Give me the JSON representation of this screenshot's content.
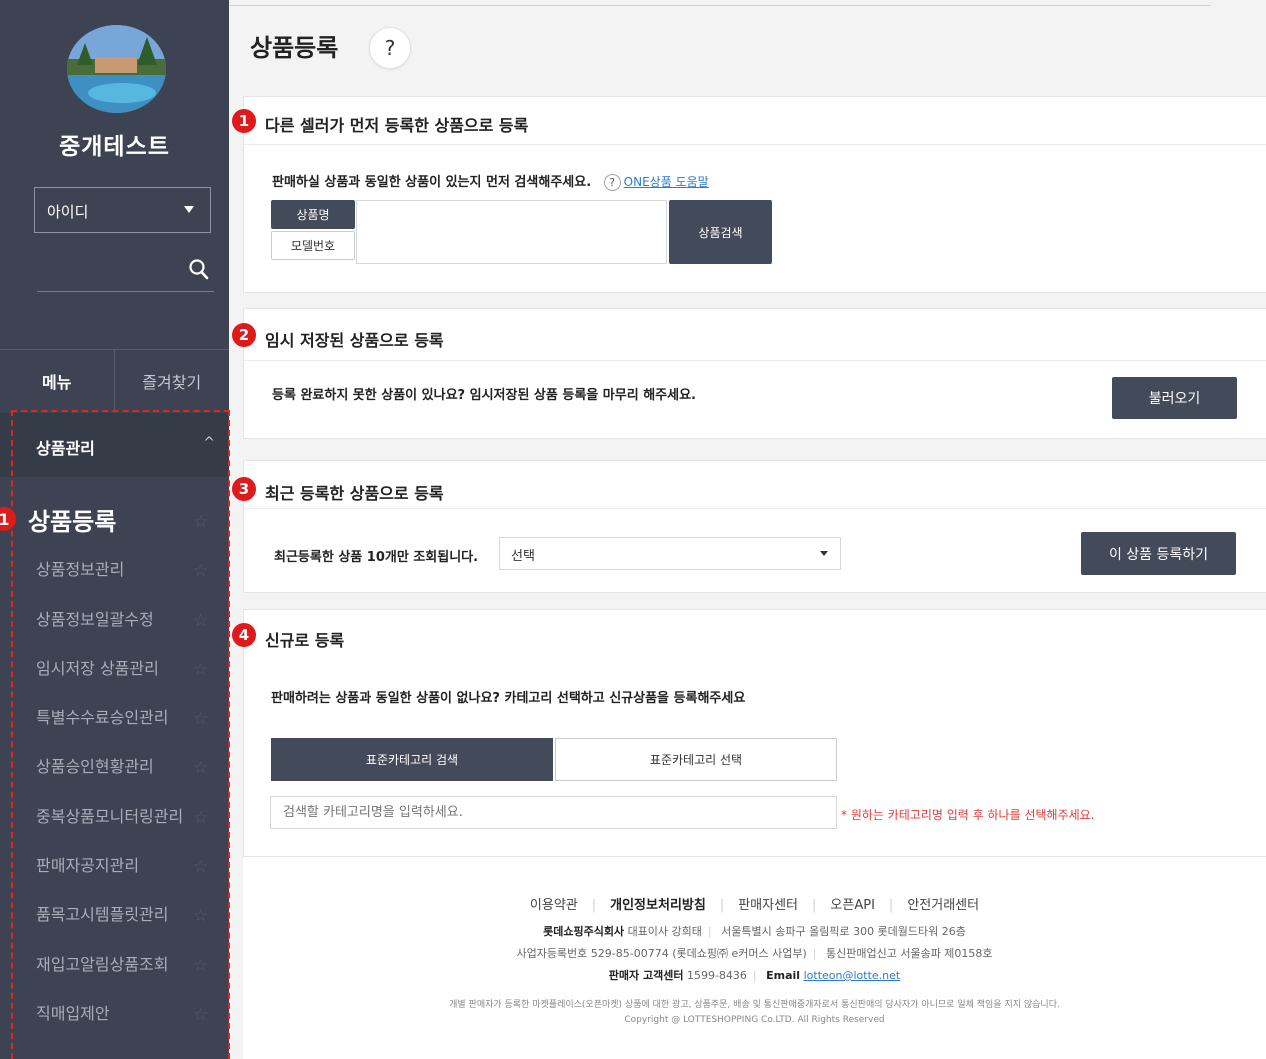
{
  "sidebar": {
    "shop_name": "중개테스트",
    "id_select": "아이디",
    "tabs": {
      "menu": "메뉴",
      "favorites": "즐겨찾기"
    },
    "group_title": "상품관리",
    "badge_num": "1",
    "items": [
      {
        "label": "상품등록"
      },
      {
        "label": "상품정보관리"
      },
      {
        "label": "상품정보일괄수정"
      },
      {
        "label": "임시저장 상품관리"
      },
      {
        "label": "특별수수료승인관리"
      },
      {
        "label": "상품승인현황관리"
      },
      {
        "label": "중복상품모니터링관리"
      },
      {
        "label": "판매자공지관리"
      },
      {
        "label": "품목고시템플릿관리"
      },
      {
        "label": "재입고알림상품조회"
      },
      {
        "label": "직매입제안"
      }
    ]
  },
  "page": {
    "title": "상품등록",
    "help_mark": "?"
  },
  "section1": {
    "num": "1",
    "title": "다른 셀러가 먼저 등록한 상품으로 등록",
    "desc": "판매하실 상품과 동일한 상품이 있는지 먼저 검색해주세요.",
    "help_mark": "?",
    "help_link": "ONE상품 도움말",
    "tab_name": "상품명",
    "tab_model": "모델번호",
    "search_btn": "상품검색"
  },
  "section2": {
    "num": "2",
    "title": "임시 저장된 상품으로 등록",
    "desc": "등록 완료하지 못한 상품이 있나요? 임시저장된 상품 등록을 마무리 해주세요.",
    "load_btn": "불러오기"
  },
  "section3": {
    "num": "3",
    "title": "최근 등록한 상품으로 등록",
    "desc": "최근등록한 상품 10개만 조회됩니다.",
    "select_value": "선택",
    "register_btn": "이 상품 등록하기"
  },
  "section4": {
    "num": "4",
    "title": "신규로 등록",
    "desc": "판매하려는 상품과 동일한 상품이 없나요? 카테고리 선택하고 신규상품을 등록해주세요",
    "tab_search": "표준카테고리 검색",
    "tab_select": "표준카테고리 선택",
    "input_placeholder": "검색할 카테고리명을 입력하세요.",
    "hint": "* 원하는 카테고리명 입력 후 하나를 선택해주세요."
  },
  "footer": {
    "links": [
      "이용약관",
      "개인정보처리방침",
      "판매자센터",
      "오픈API",
      "안전거래센터"
    ],
    "company": "롯데쇼핑주식회사",
    "ceo_label": "대표이사",
    "ceo": "강희태",
    "address": "서울특별시 송파구 올림픽로 300 롯데월드타워 26층",
    "biz_no_label": "사업자등록번호",
    "biz_no": "529-85-00774 (롯데쇼핑㈜ e커머스 사업부)",
    "mail_order_label": "통신판매업신고",
    "mail_order": "서울송파 제0158호",
    "cs_label": "판매자 고객센터",
    "cs_phone": "1599-8436",
    "email_label": "Email",
    "email": "lotteon@lotte.net",
    "disclaimer": "개별 판매자가 등록한 마켓플레이스(오픈마켓) 상품에 대한 광고, 상품주문, 배송 및 통신판매중개자로서 통신판매의 당사자가 아니므로 일체 책임을 지지 않습니다.",
    "copyright": "Copyright @ LOTTESHOPPING Co.LTD. All Rights Reserved"
  },
  "colors": {
    "sidebar_bg": "#3d4352",
    "accent_dark": "#434a5a",
    "badge_red": "#df1a1a",
    "hint_red": "#e23c3c",
    "link_blue": "#2a7ad6"
  }
}
